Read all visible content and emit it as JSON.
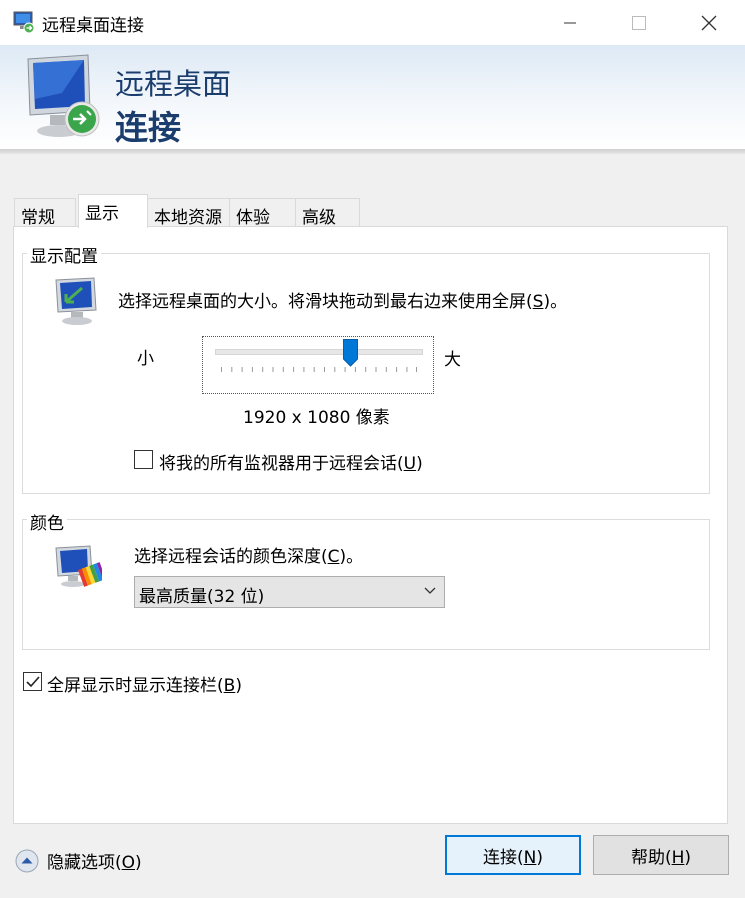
{
  "window": {
    "title": "远程桌面连接"
  },
  "banner": {
    "line1": "远程桌面",
    "line2": "连接"
  },
  "tabs": [
    {
      "label": "常规"
    },
    {
      "label": "显示"
    },
    {
      "label": "本地资源"
    },
    {
      "label": "体验"
    },
    {
      "label": "高级"
    }
  ],
  "display_config": {
    "group_label": "显示配置",
    "description": "选择远程桌面的大小。将滑块拖动到最右边来使用全屏(",
    "description_key": "S",
    "description_end": ")。",
    "slider_min_label": "小",
    "slider_max_label": "大",
    "slider_position": 0.65,
    "resolution_text": "1920 x 1080 像素",
    "multi_monitor_label": "将我的所有监视器用于远程会话(",
    "multi_monitor_key": "U",
    "multi_monitor_end": ")",
    "multi_monitor_checked": false
  },
  "colors": {
    "group_label": "颜色",
    "description": "选择远程会话的颜色深度(",
    "description_key": "C",
    "description_end": ")。",
    "selected_depth": "最高质量(32 位)"
  },
  "connection_bar": {
    "label": "全屏显示时显示连接栏(",
    "key": "B",
    "end": ")",
    "checked": true
  },
  "footer": {
    "hide_options_label": "隐藏选项(",
    "hide_options_key": "O",
    "hide_options_end": ")",
    "connect_label": "连接(",
    "connect_key": "N",
    "connect_end": ")",
    "help_label": "帮助(",
    "help_key": "H",
    "help_end": ")"
  },
  "colors_theme": {
    "accent": "#0078d7",
    "banner_text": "#1a3d6e"
  },
  "icons": {
    "app": "remote-desktop-icon",
    "banner": "remote-desktop-monitor-icon",
    "display": "display-settings-icon",
    "color": "color-depth-icon"
  }
}
